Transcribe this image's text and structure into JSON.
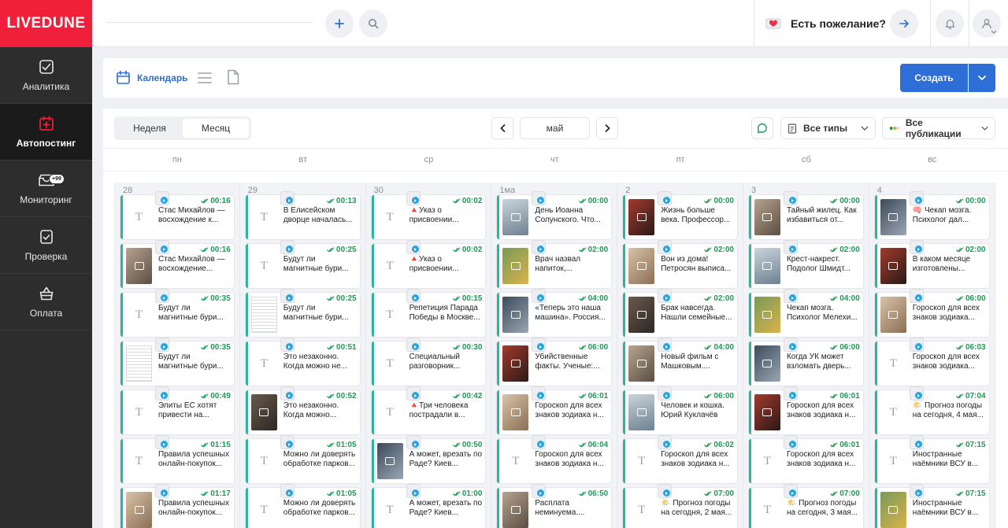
{
  "app": {
    "logo": "LIVEDUNE"
  },
  "sidebar": [
    {
      "label": "Аналитика",
      "icon": "analytics-icon",
      "active": false
    },
    {
      "label": "Автопостинг",
      "icon": "autoposting-icon",
      "active": true
    },
    {
      "label": "Мониторинг",
      "icon": "monitoring-icon",
      "active": false,
      "badge": "+99"
    },
    {
      "label": "Проверка",
      "icon": "check-icon",
      "active": false
    },
    {
      "label": "Оплата",
      "icon": "payment-icon",
      "active": false
    }
  ],
  "topbar": {
    "wish_label": "Есть пожелание?"
  },
  "toolbar": {
    "calendar_label": "Календарь",
    "create_label": "Создать"
  },
  "view": {
    "week": "Неделя",
    "month": "Месяц",
    "active": "month"
  },
  "nav": {
    "month": "май"
  },
  "filters": {
    "types": "Все типы",
    "publications": "Все публикации"
  },
  "weekdays": [
    "пн",
    "вт",
    "ср",
    "чт",
    "пт",
    "сб",
    "вс"
  ],
  "colors": {
    "accent": "#2d6fd6",
    "brand": "#f0203a",
    "card_border": "#2bb59a",
    "time": "#1a9d55"
  },
  "days": [
    {
      "num": "28",
      "posts": [
        {
          "time": "00:16",
          "text": "Стас Михайлов — восхождение к...",
          "thumb": "text"
        },
        {
          "time": "00:16",
          "text": "Стас Михайлов — восхождение...",
          "thumb": "img"
        },
        {
          "time": "00:35",
          "text": "Будут ли магнитные бури...",
          "thumb": "text"
        },
        {
          "time": "00:35",
          "text": "Будут ли магнитные бури...",
          "thumb": "doc"
        },
        {
          "time": "00:49",
          "text": "Элиты ЕС хотят привести на...",
          "thumb": "text"
        },
        {
          "time": "01:15",
          "text": "Правила успешных онлайн-покупок...",
          "thumb": "text"
        },
        {
          "time": "01:17",
          "text": "Правила успешных онлайн-покупок...",
          "thumb": "img"
        }
      ]
    },
    {
      "num": "29",
      "posts": [
        {
          "time": "00:13",
          "text": "В Елисейском дворце началась...",
          "thumb": "text"
        },
        {
          "time": "00:25",
          "text": "Будут ли магнитные бури...",
          "thumb": "text"
        },
        {
          "time": "00:25",
          "text": "Будут ли магнитные бури...",
          "thumb": "doc"
        },
        {
          "time": "00:51",
          "text": "Это незаконно. Когда можно не...",
          "thumb": "text"
        },
        {
          "time": "00:52",
          "text": "Это незаконно. Когда можно...",
          "thumb": "img"
        },
        {
          "time": "01:05",
          "text": "Можно ли доверять обработке парков...",
          "thumb": "text"
        },
        {
          "time": "01:05",
          "text": "Можно ли доверять обработке парков...",
          "thumb": "text"
        }
      ]
    },
    {
      "num": "30",
      "posts": [
        {
          "time": "00:02",
          "text": "🔺Указ о присвоении...",
          "thumb": "text"
        },
        {
          "time": "00:02",
          "text": "🔺Указ о присвоении...",
          "thumb": "text"
        },
        {
          "time": "00:15",
          "text": "Репетиция Парада Победы в Москве...",
          "thumb": "text"
        },
        {
          "time": "00:30",
          "text": "Специальный разговорник...",
          "thumb": "text"
        },
        {
          "time": "00:42",
          "text": "🔺Три человека пострадали в...",
          "thumb": "text"
        },
        {
          "time": "00:50",
          "text": "А может, врезать по Раде? Киев...",
          "thumb": "img"
        },
        {
          "time": "01:00",
          "text": "А может, врезать по Раде? Киев...",
          "thumb": "text"
        }
      ]
    },
    {
      "num": "1ма",
      "posts": [
        {
          "time": "00:00",
          "text": "День Иоанна Солунского. Что...",
          "thumb": "img"
        },
        {
          "time": "02:00",
          "text": "Врач назвал напиток,...",
          "thumb": "img"
        },
        {
          "time": "04:00",
          "text": "«Теперь это наша машина». Россия...",
          "thumb": "img"
        },
        {
          "time": "06:00",
          "text": "Убийственные факты. Ученые:...",
          "thumb": "img"
        },
        {
          "time": "06:01",
          "text": "Гороскоп для всех знаков зодиака н...",
          "thumb": "img"
        },
        {
          "time": "06:04",
          "text": "Гороскоп для всех знаков зодиака н...",
          "thumb": "text"
        },
        {
          "time": "06:50",
          "text": "Расплата неминуема....",
          "thumb": "img"
        }
      ]
    },
    {
      "num": "2",
      "posts": [
        {
          "time": "00:00",
          "text": "Жизнь больше века. Профессор...",
          "thumb": "img"
        },
        {
          "time": "02:00",
          "text": "Вон из дома! Петросян выписа...",
          "thumb": "img"
        },
        {
          "time": "02:00",
          "text": "Брак навсегда. Нашли семейные...",
          "thumb": "img"
        },
        {
          "time": "04:00",
          "text": "Новый фильм с Машковым....",
          "thumb": "img"
        },
        {
          "time": "06:00",
          "text": "Человек и кошка. Юрий Куклачёв —...",
          "thumb": "img"
        },
        {
          "time": "06:02",
          "text": "Гороскоп для всех знаков зодиака н...",
          "thumb": "text"
        },
        {
          "time": "07:00",
          "text": "🌤️ Прогноз погоды на сегодня, 2 мая...",
          "thumb": "text"
        }
      ]
    },
    {
      "num": "3",
      "posts": [
        {
          "time": "00:00",
          "text": "Тайный жилец. Как избавиться от...",
          "thumb": "img"
        },
        {
          "time": "02:00",
          "text": "Крест-накрест. Подолог Шмидт...",
          "thumb": "img"
        },
        {
          "time": "04:00",
          "text": "Чекап мозга. Психолог Мелехи...",
          "thumb": "img"
        },
        {
          "time": "06:00",
          "text": "Когда УК может взломать дверь...",
          "thumb": "img"
        },
        {
          "time": "06:01",
          "text": "Гороскоп для всех знаков зодиака н...",
          "thumb": "img"
        },
        {
          "time": "06:01",
          "text": "Гороскоп для всех знаков зодиака н...",
          "thumb": "text"
        },
        {
          "time": "07:00",
          "text": "🌤️ Прогноз погоды на сегодня, 3 мая...",
          "thumb": "text"
        }
      ]
    },
    {
      "num": "4",
      "posts": [
        {
          "time": "00:00",
          "text": "🧠 Чекап мозга. Психолог дал...",
          "thumb": "img"
        },
        {
          "time": "02:00",
          "text": "В каком месяце изготовлены...",
          "thumb": "img"
        },
        {
          "time": "06:00",
          "text": "Гороскоп для всех знаков зодиака...",
          "thumb": "img"
        },
        {
          "time": "06:03",
          "text": "Гороскоп для всех знаков зодиака...",
          "thumb": "text"
        },
        {
          "time": "07:04",
          "text": "🌤️ Прогноз погоды на сегодня, 4 мая...",
          "thumb": "text"
        },
        {
          "time": "07:15",
          "text": "Иностранные наёмники ВСУ в...",
          "thumb": "text"
        },
        {
          "time": "07:15",
          "text": "Иностранные наёмники ВСУ в...",
          "thumb": "img"
        }
      ]
    }
  ]
}
